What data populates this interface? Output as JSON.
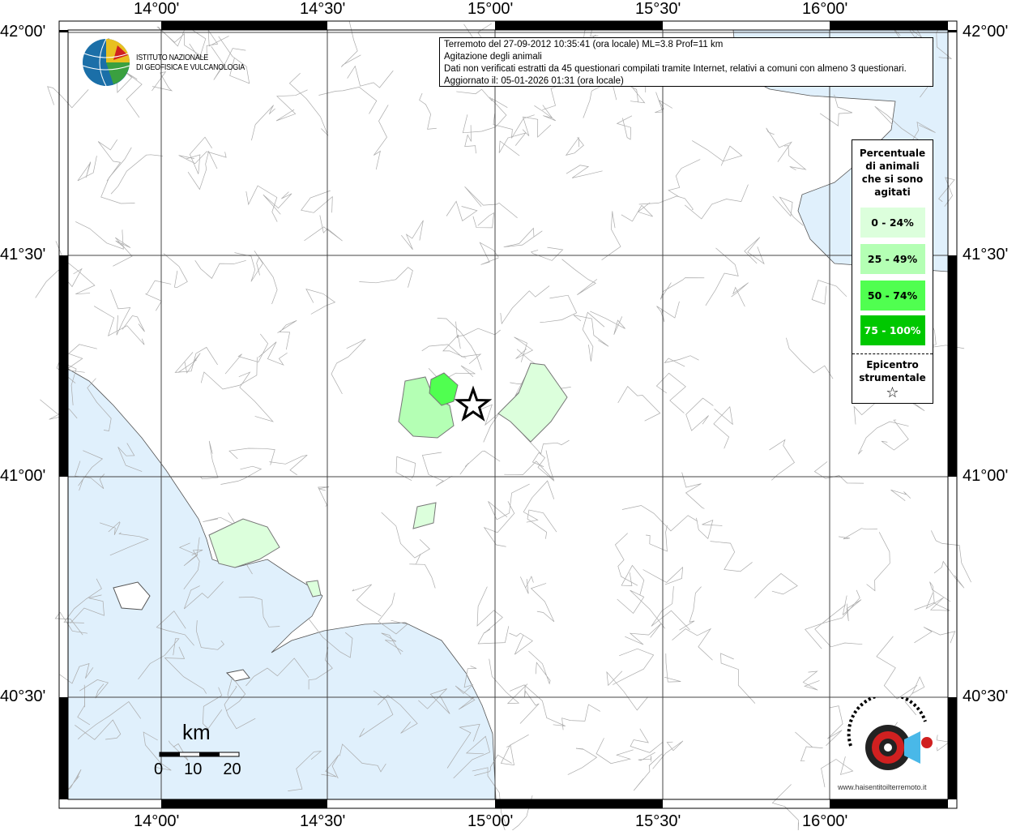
{
  "info": {
    "line1": "Terremoto del 27-09-2012 10:35:41 (ora locale) ML=3.8 Prof=11 km",
    "line2": "Agitazione degli animali",
    "line3": "Dati non verificati estratti da 45 questionari compilati tramite Internet, relativi a comuni con almeno 3 questionari.",
    "line4": "Aggiornato il: 05-01-2026 01:31 (ora locale)"
  },
  "logo": {
    "line1": "ISTITUTO NAZIONALE",
    "line2": "DI GEOFISICA E VULCANOLOGIA"
  },
  "axes": {
    "lon": [
      "14°00'",
      "14°30'",
      "15°00'",
      "15°30'",
      "16°00'"
    ],
    "lat": [
      "42°00'",
      "41°30'",
      "41°00'",
      "40°30'"
    ]
  },
  "legend": {
    "title": [
      "Percentuale",
      "di animali",
      "che si sono",
      "agitati"
    ],
    "classes": [
      {
        "label": "0 - 24%",
        "color": "#dcffdc"
      },
      {
        "label": "25 - 49%",
        "color": "#b4ffb4"
      },
      {
        "label": "50 - 74%",
        "color": "#50ff50"
      },
      {
        "label": "75 - 100%",
        "color": "#00c800"
      }
    ],
    "epicentre": [
      "Epicentro",
      "strumentale"
    ]
  },
  "scale": {
    "unit": "km",
    "ticks": [
      "0",
      "10",
      "20"
    ]
  },
  "watermark": "www.haisentitoilterremoto.it",
  "colors": {
    "sea": "#e0f0fc",
    "grid": "#444"
  }
}
